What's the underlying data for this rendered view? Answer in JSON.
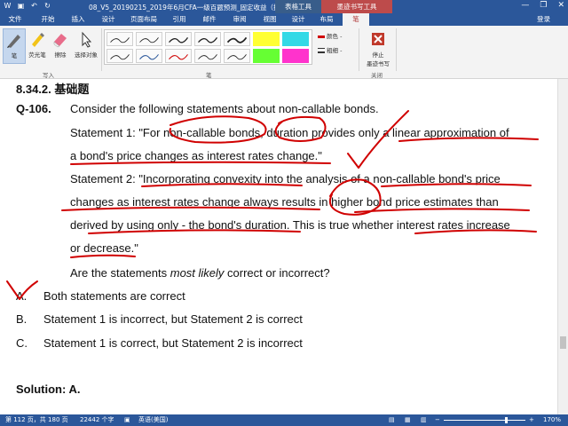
{
  "titlebar": {
    "title": "08_V5_20190215_2019年6月CFA一级百题预测_固定收益（授...",
    "context_table_tools": "表格工具",
    "context_ink_tools": "墨迹书写工具",
    "minimize": "—",
    "restore": "❐",
    "close": "✕"
  },
  "tabs": {
    "file": "文件",
    "home": "开始",
    "insert": "插入",
    "design": "设计",
    "layout": "页面布局",
    "references": "引用",
    "mailings": "邮件",
    "review": "审阅",
    "view": "视图",
    "table_design": "设计",
    "table_layout": "布局",
    "pens": "笔",
    "login": "登录"
  },
  "ribbon": {
    "pen_label": "笔",
    "highlighter_label": "荧光笔",
    "eraser_label": "擦除",
    "select_label": "选择对象",
    "group_write": "写入",
    "group_pens": "笔",
    "color_label": "颜色 -",
    "thickness_label": "粗细 -",
    "stop_label_1": "停止",
    "stop_label_2": "墨迹书写",
    "group_close": "关闭",
    "pen_colors": [
      "#000000",
      "#000000",
      "#000000",
      "#000000",
      "#000000",
      "#000000",
      "#2b579a",
      "#ff0000",
      "#000000",
      "#000000"
    ],
    "highlighter_colors": [
      "#ffff00",
      "#33d9e6",
      "#66ff33",
      "#ff33cc"
    ]
  },
  "document": {
    "heading": "8.34.2.  基础题",
    "qnum": "Q-106.",
    "q_text": "Consider the following statements about non-callable bonds.",
    "s1_line1": "Statement 1: \"For non-callable bonds, duration provides only a linear approximation of",
    "s1_line2": "a bond's price changes as interest rates change.\"",
    "s2_line1": "Statement 2: \"Incorporating convexity into the analysis of a non-callable bond's price",
    "s2_line2": "changes as interest rates change always results in higher bond price estimates than",
    "s2_line3": "derived by using only - the bond's duration. This is true whether interest rates increase",
    "s2_line4": "or decrease.\"",
    "prompt_pre": "Are the statements ",
    "prompt_italic": "most likely",
    "prompt_post": " correct or incorrect?",
    "opt_a_letter": "A.",
    "opt_a_text": "Both statements are correct",
    "opt_b_letter": "B.",
    "opt_b_text": "Statement 1 is incorrect, but Statement 2 is correct",
    "opt_c_letter": "C.",
    "opt_c_text": "Statement 1 is correct, but Statement 2 is incorrect",
    "solution": "Solution: A."
  },
  "statusbar": {
    "page": "第 112 页，共 180 页",
    "words": "22442 个字",
    "language": "英语(美国)",
    "zoom": "170%"
  },
  "ink_color": "#d00000"
}
